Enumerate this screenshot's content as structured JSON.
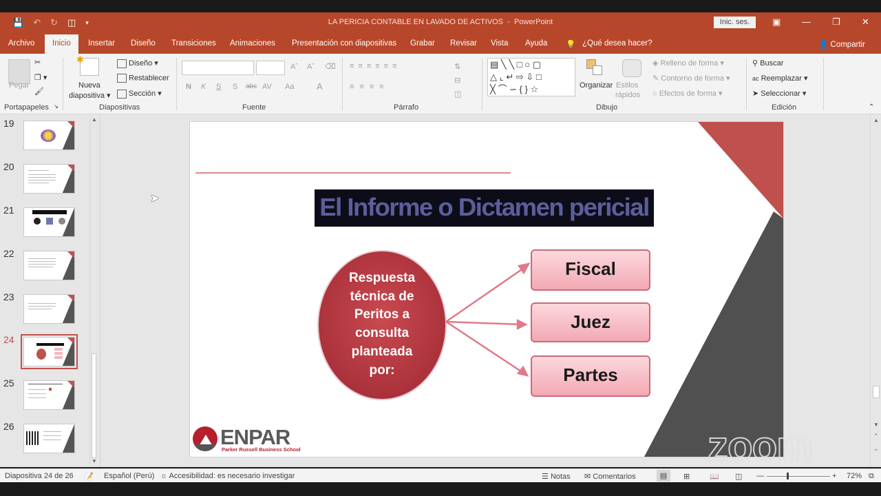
{
  "window": {
    "title": "LA PERICIA CONTABLE EN LAVADO DE ACTIVOS",
    "app": "PowerPoint",
    "signin": "Inic. ses."
  },
  "menu": {
    "items": [
      "Archivo",
      "Inicio",
      "Insertar",
      "Diseño",
      "Transiciones",
      "Animaciones",
      "Presentación con diapositivas",
      "Grabar",
      "Revisar",
      "Vista",
      "Ayuda"
    ],
    "active": "Inicio",
    "tell_me": "¿Qué desea hacer?",
    "share": "Compartir"
  },
  "ribbon": {
    "clipboard": {
      "paste": "Pegar",
      "label": "Portapapeles"
    },
    "slides": {
      "new_slide_1": "Nueva",
      "new_slide_2": "diapositiva",
      "layout": "Diseño",
      "reset": "Restablecer",
      "section": "Sección",
      "label": "Diapositivas"
    },
    "font": {
      "label": "Fuente",
      "bold": "N",
      "italic": "K",
      "underline": "S",
      "shadow": "S",
      "strike": "abc",
      "spacing": "AV",
      "case": "Aa",
      "color": "A"
    },
    "paragraph": {
      "label": "Párrafo"
    },
    "drawing": {
      "arrange": "Organizar",
      "quick_styles_1": "Estilos",
      "quick_styles_2": "rápidos",
      "fill": "Relleno de forma",
      "outline": "Contorno de forma",
      "effects": "Efectos de forma",
      "label": "Dibujo"
    },
    "editing": {
      "find": "Buscar",
      "replace": "Reemplazar",
      "select": "Seleccionar",
      "label": "Edición"
    }
  },
  "thumbnails": [
    {
      "num": "19"
    },
    {
      "num": "20"
    },
    {
      "num": "21"
    },
    {
      "num": "22"
    },
    {
      "num": "23"
    },
    {
      "num": "24",
      "selected": true
    },
    {
      "num": "25"
    },
    {
      "num": "26"
    }
  ],
  "slide": {
    "title": "El Informe o Dictamen pericial",
    "circle_text": [
      "Respuesta",
      "técnica de",
      "Peritos a",
      "consulta",
      "planteada",
      "por:"
    ],
    "boxes": [
      "Fiscal",
      "Juez",
      "Partes"
    ],
    "logo_name": "ENPAR",
    "logo_sub": "Parker Russell Business School",
    "watermark": "zoom"
  },
  "status": {
    "slide_pos": "Diapositiva 24 de 26",
    "language": "Español (Perú)",
    "accessibility": "Accesibilidad: es necesario investigar",
    "notes": "Notas",
    "comments": "Comentarios",
    "zoom": "72%"
  },
  "colors": {
    "accent": "#b7472a",
    "slide_red": "#c0504d",
    "slide_gray": "#505050",
    "box_pink": "#f4b7c0"
  }
}
